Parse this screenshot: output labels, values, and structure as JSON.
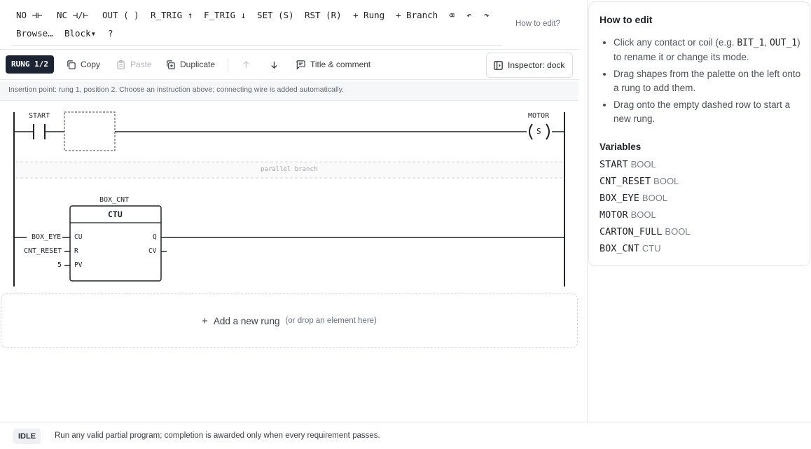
{
  "toolbar": {
    "row1": [
      "NO ⊣⊢",
      "NC ⊣/⊢",
      "OUT ( )",
      "R_TRIG ↑",
      "F_TRIG ↓",
      "SET (S)",
      "RST (R)",
      "+ Rung",
      "+ Branch",
      "⌫",
      "↶",
      "↷"
    ],
    "row2": [
      "Browse…",
      "Block▾",
      "?"
    ],
    "how_to_edit": "How to edit?"
  },
  "actionbar": {
    "rung_badge": "RUNG 1/2",
    "copy": "Copy",
    "paste": "Paste",
    "duplicate": "Duplicate",
    "title_comment": "Title & comment",
    "inspector": "Inspector: dock"
  },
  "hint": "Insertion point: rung 1, position 2. Choose an instruction above; connecting wire is added automatically.",
  "ladder": {
    "contact_start": "START",
    "coil_motor": "MOTOR",
    "coil_mode": "S",
    "parallel_branch": "parallel branch",
    "block": {
      "instance": "BOX_CNT",
      "type": "CTU",
      "in_cu": "CU",
      "in_r": "R",
      "in_pv": "PV",
      "out_q": "Q",
      "out_cv": "CV",
      "arg_cu": "BOX_EYE",
      "arg_r": "CNT_RESET",
      "arg_pv": "5"
    }
  },
  "add_rung": {
    "plus": "+",
    "label": "Add a new rung",
    "sub": "(or drop an element here)"
  },
  "status": {
    "badge": "IDLE",
    "text": "Run any valid partial program; completion is awarded only when every requirement passes."
  },
  "inspector": {
    "title": "How to edit",
    "tip1_pre": "Click any contact or coil (e.g. ",
    "tip1_code1": "BIT_1",
    "tip1_mid": ", ",
    "tip1_code2": "OUT_1",
    "tip1_post": ") to rename it or change its mode.",
    "tip2": "Drag shapes from the palette on the left onto a rung to add them.",
    "tip3": "Drag onto the empty dashed row to start a new rung.",
    "vars_title": "Variables",
    "variables": [
      {
        "name": "START",
        "type": "BOOL"
      },
      {
        "name": "CNT_RESET",
        "type": "BOOL"
      },
      {
        "name": "BOX_EYE",
        "type": "BOOL"
      },
      {
        "name": "MOTOR",
        "type": "BOOL"
      },
      {
        "name": "CARTON_FULL",
        "type": "BOOL"
      },
      {
        "name": "BOX_CNT",
        "type": "CTU"
      }
    ]
  }
}
